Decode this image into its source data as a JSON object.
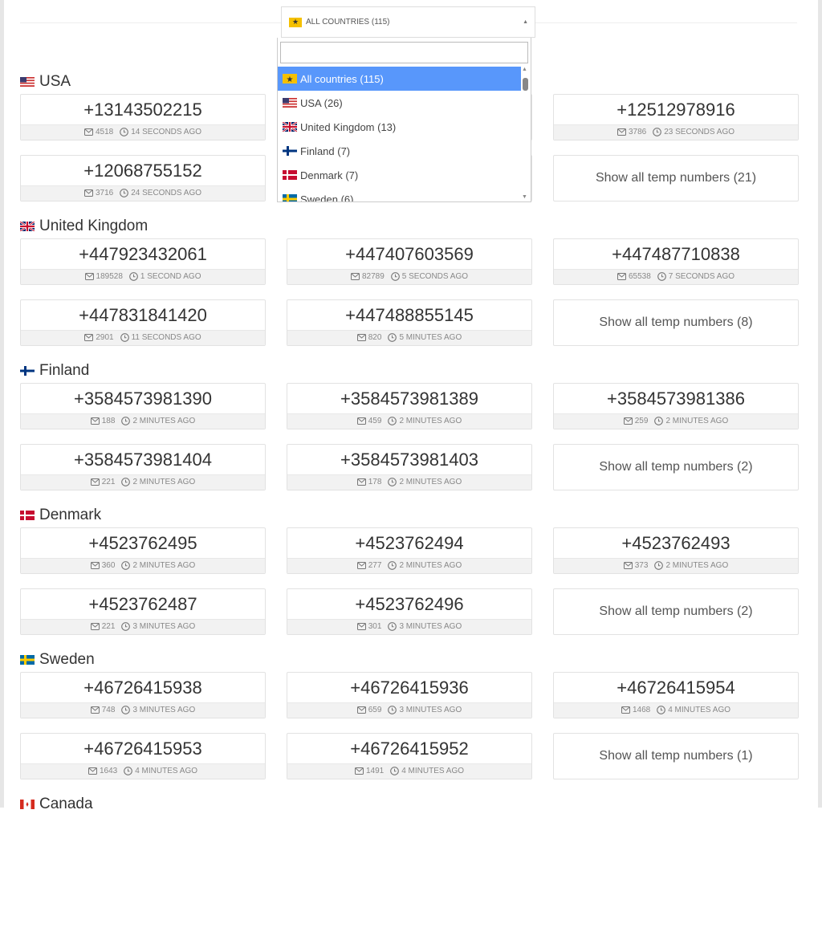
{
  "select": {
    "label": "ALL COUNTRIES (115)",
    "icon": "star-icon"
  },
  "dropdown": {
    "search_value": "",
    "items": [
      {
        "label": "All countries (115)",
        "flag": "star",
        "active": true
      },
      {
        "label": "USA (26)",
        "flag": "us"
      },
      {
        "label": "United Kingdom (13)",
        "flag": "gb"
      },
      {
        "label": "Finland (7)",
        "flag": "fi"
      },
      {
        "label": "Denmark (7)",
        "flag": "dk"
      },
      {
        "label": "Sweden (6)",
        "flag": "se"
      }
    ]
  },
  "colors": {
    "highlight": "#5897fb"
  },
  "sections": [
    {
      "country": "USA",
      "flag": "us",
      "numbers": [
        {
          "number": "+13143502215",
          "messages": "4518",
          "time": "14 SECONDS AGO"
        },
        {
          "number": "",
          "messages": "",
          "time": ""
        },
        {
          "number": "+12512978916",
          "messages": "3786",
          "time": "23 SECONDS AGO"
        },
        {
          "number": "+12068755152",
          "messages": "3716",
          "time": "24 SECONDS AGO"
        },
        {
          "number": "",
          "messages": "",
          "time": ""
        }
      ],
      "show_all": "Show all temp numbers (21)"
    },
    {
      "country": "United Kingdom",
      "flag": "gb",
      "numbers": [
        {
          "number": "+447923432061",
          "messages": "189528",
          "time": "1 SECOND AGO"
        },
        {
          "number": "+447407603569",
          "messages": "82789",
          "time": "5 SECONDS AGO"
        },
        {
          "number": "+447487710838",
          "messages": "65538",
          "time": "7 SECONDS AGO"
        },
        {
          "number": "+447831841420",
          "messages": "2901",
          "time": "11 SECONDS AGO"
        },
        {
          "number": "+447488855145",
          "messages": "820",
          "time": "5 MINUTES AGO"
        }
      ],
      "show_all": "Show all temp numbers (8)"
    },
    {
      "country": "Finland",
      "flag": "fi",
      "numbers": [
        {
          "number": "+3584573981390",
          "messages": "188",
          "time": "2 MINUTES AGO"
        },
        {
          "number": "+3584573981389",
          "messages": "459",
          "time": "2 MINUTES AGO"
        },
        {
          "number": "+3584573981386",
          "messages": "259",
          "time": "2 MINUTES AGO"
        },
        {
          "number": "+3584573981404",
          "messages": "221",
          "time": "2 MINUTES AGO"
        },
        {
          "number": "+3584573981403",
          "messages": "178",
          "time": "2 MINUTES AGO"
        }
      ],
      "show_all": "Show all temp numbers (2)"
    },
    {
      "country": "Denmark",
      "flag": "dk",
      "numbers": [
        {
          "number": "+4523762495",
          "messages": "360",
          "time": "2 MINUTES AGO"
        },
        {
          "number": "+4523762494",
          "messages": "277",
          "time": "2 MINUTES AGO"
        },
        {
          "number": "+4523762493",
          "messages": "373",
          "time": "2 MINUTES AGO"
        },
        {
          "number": "+4523762487",
          "messages": "221",
          "time": "3 MINUTES AGO"
        },
        {
          "number": "+4523762496",
          "messages": "301",
          "time": "3 MINUTES AGO"
        }
      ],
      "show_all": "Show all temp numbers (2)"
    },
    {
      "country": "Sweden",
      "flag": "se",
      "numbers": [
        {
          "number": "+46726415938",
          "messages": "748",
          "time": "3 MINUTES AGO"
        },
        {
          "number": "+46726415936",
          "messages": "659",
          "time": "3 MINUTES AGO"
        },
        {
          "number": "+46726415954",
          "messages": "1468",
          "time": "4 MINUTES AGO"
        },
        {
          "number": "+46726415953",
          "messages": "1643",
          "time": "4 MINUTES AGO"
        },
        {
          "number": "+46726415952",
          "messages": "1491",
          "time": "4 MINUTES AGO"
        }
      ],
      "show_all": "Show all temp numbers (1)"
    },
    {
      "country": "Canada",
      "flag": "ca",
      "numbers": [],
      "show_all": ""
    }
  ]
}
